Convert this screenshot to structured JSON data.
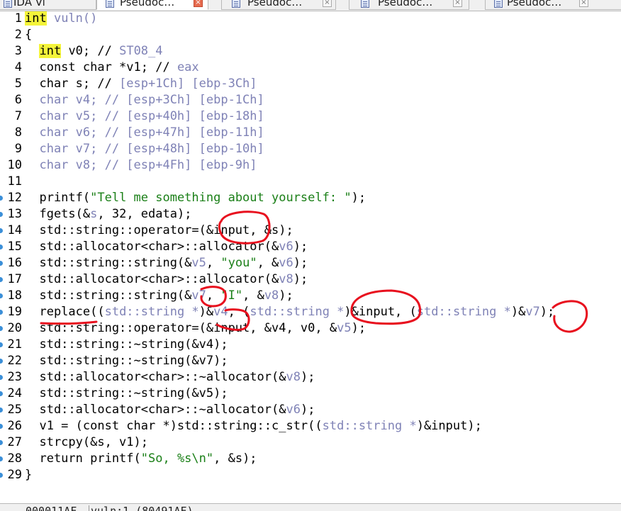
{
  "tabs": [
    {
      "label": "IDA Vi",
      "active": false,
      "icon": "ida-view-icon",
      "has_close": false
    },
    {
      "label": "Pseudoc…",
      "active": true,
      "icon": "pseudocode-icon",
      "has_close": true
    },
    {
      "label": "Pseudoc…",
      "active": false,
      "icon": "pseudocode-icon",
      "has_close": true
    },
    {
      "label": "Pseudoc…",
      "active": false,
      "icon": "pseudocode-icon",
      "has_close": true
    },
    {
      "label": "Pseudoc…",
      "active": false,
      "icon": "pseudocode-icon",
      "has_close": true
    }
  ],
  "code_lines": [
    {
      "n": "1",
      "bp": false,
      "tokens": [
        {
          "t": "int",
          "c": "kw"
        },
        {
          "t": " vuln()",
          "c": "g"
        }
      ]
    },
    {
      "n": "2",
      "bp": false,
      "tokens": [
        {
          "t": "{"
        }
      ]
    },
    {
      "n": "3",
      "bp": false,
      "tokens": [
        {
          "t": "  "
        },
        {
          "t": "int",
          "c": "kw"
        },
        {
          "t": " v0; // "
        },
        {
          "t": "ST08_4",
          "c": "g"
        }
      ]
    },
    {
      "n": "4",
      "bp": false,
      "tokens": [
        {
          "t": "  const char *v1; // "
        },
        {
          "t": "eax",
          "c": "g"
        }
      ]
    },
    {
      "n": "5",
      "bp": false,
      "tokens": [
        {
          "t": "  char s; // "
        },
        {
          "t": "[esp+1Ch] [ebp-3Ch]",
          "c": "g"
        }
      ]
    },
    {
      "n": "6",
      "bp": false,
      "tokens": [
        {
          "t": "  char v4; // [esp+3Ch] [ebp-1Ch]",
          "c": "g"
        }
      ]
    },
    {
      "n": "7",
      "bp": false,
      "tokens": [
        {
          "t": "  char v5; // [esp+40h] [ebp-18h]",
          "c": "g"
        }
      ]
    },
    {
      "n": "8",
      "bp": false,
      "tokens": [
        {
          "t": "  char v6; // [esp+47h] [ebp-11h]",
          "c": "g"
        }
      ]
    },
    {
      "n": "9",
      "bp": false,
      "tokens": [
        {
          "t": "  char v7; // [esp+48h] [ebp-10h]",
          "c": "g"
        }
      ]
    },
    {
      "n": "10",
      "bp": false,
      "tokens": [
        {
          "t": "  char v8; // [esp+4Fh] [ebp-9h]",
          "c": "g"
        }
      ]
    },
    {
      "n": "11",
      "bp": false,
      "tokens": []
    },
    {
      "n": "12",
      "bp": true,
      "tokens": [
        {
          "t": "  printf("
        },
        {
          "t": "\"Tell me something about yourself: \"",
          "c": "s"
        },
        {
          "t": ");"
        }
      ]
    },
    {
      "n": "13",
      "bp": true,
      "tokens": [
        {
          "t": "  fgets(&"
        },
        {
          "t": "s",
          "c": "g"
        },
        {
          "t": ", 32, edata);"
        }
      ]
    },
    {
      "n": "14",
      "bp": true,
      "tokens": [
        {
          "t": "  std::string::operator=(&input, &s);"
        }
      ]
    },
    {
      "n": "15",
      "bp": true,
      "tokens": [
        {
          "t": "  std::allocator<char>::allocator(&"
        },
        {
          "t": "v6",
          "c": "g"
        },
        {
          "t": ");"
        }
      ]
    },
    {
      "n": "16",
      "bp": true,
      "tokens": [
        {
          "t": "  std::string::string(&"
        },
        {
          "t": "v5",
          "c": "g"
        },
        {
          "t": ", "
        },
        {
          "t": "\"you\"",
          "c": "s"
        },
        {
          "t": ", &"
        },
        {
          "t": "v6",
          "c": "g"
        },
        {
          "t": ");"
        }
      ]
    },
    {
      "n": "17",
      "bp": true,
      "tokens": [
        {
          "t": "  std::allocator<char>::allocator(&"
        },
        {
          "t": "v8",
          "c": "g"
        },
        {
          "t": ");"
        }
      ]
    },
    {
      "n": "18",
      "bp": true,
      "tokens": [
        {
          "t": "  std::string::string(&"
        },
        {
          "t": "v7",
          "c": "g"
        },
        {
          "t": ", "
        },
        {
          "t": "\"I\"",
          "c": "s"
        },
        {
          "t": ", &"
        },
        {
          "t": "v8",
          "c": "g"
        },
        {
          "t": ");"
        }
      ]
    },
    {
      "n": "19",
      "bp": true,
      "tokens": [
        {
          "t": "  replace(("
        },
        {
          "t": "std::string *",
          "c": "g"
        },
        {
          "t": ")&"
        },
        {
          "t": "v4",
          "c": "g"
        },
        {
          "t": ", ("
        },
        {
          "t": "std::string *",
          "c": "g"
        },
        {
          "t": ")&input, ("
        },
        {
          "t": "std::string *",
          "c": "g"
        },
        {
          "t": ")&"
        },
        {
          "t": "v7",
          "c": "g"
        },
        {
          "t": ");"
        }
      ]
    },
    {
      "n": "20",
      "bp": true,
      "tokens": [
        {
          "t": "  std::string::operator=(&input, &v4, v0, &"
        },
        {
          "t": "v5",
          "c": "g"
        },
        {
          "t": ");"
        }
      ]
    },
    {
      "n": "21",
      "bp": true,
      "tokens": [
        {
          "t": "  std::string::~string(&v4);"
        }
      ]
    },
    {
      "n": "22",
      "bp": true,
      "tokens": [
        {
          "t": "  std::string::~string(&v7);"
        }
      ]
    },
    {
      "n": "23",
      "bp": true,
      "tokens": [
        {
          "t": "  std::allocator<char>::~allocator(&"
        },
        {
          "t": "v8",
          "c": "g"
        },
        {
          "t": ");"
        }
      ]
    },
    {
      "n": "24",
      "bp": true,
      "tokens": [
        {
          "t": "  std::string::~string(&v5);"
        }
      ]
    },
    {
      "n": "25",
      "bp": true,
      "tokens": [
        {
          "t": "  std::allocator<char>::~allocator(&"
        },
        {
          "t": "v6",
          "c": "g"
        },
        {
          "t": ");"
        }
      ]
    },
    {
      "n": "26",
      "bp": true,
      "tokens": [
        {
          "t": "  v1 = (const char *)std::string::c_str(("
        },
        {
          "t": "std::string *",
          "c": "g"
        },
        {
          "t": ")&input);"
        }
      ]
    },
    {
      "n": "27",
      "bp": true,
      "tokens": [
        {
          "t": "  strcpy(&s, v1);"
        }
      ]
    },
    {
      "n": "28",
      "bp": true,
      "tokens": [
        {
          "t": "  return printf("
        },
        {
          "t": "\"So, %s\\n\"",
          "c": "s"
        },
        {
          "t": ", &s);"
        }
      ]
    },
    {
      "n": "29",
      "bp": true,
      "tokens": [
        {
          "t": "}"
        }
      ]
    }
  ],
  "statusbar": {
    "address": "000011AF",
    "location": "vuln:1 (80491AF)"
  },
  "colors": {
    "keyword_highlight": "#f4f43a",
    "gray_token": "#7f82b6",
    "string_literal": "#1a7f17",
    "annotation_ink": "#e8101e"
  }
}
